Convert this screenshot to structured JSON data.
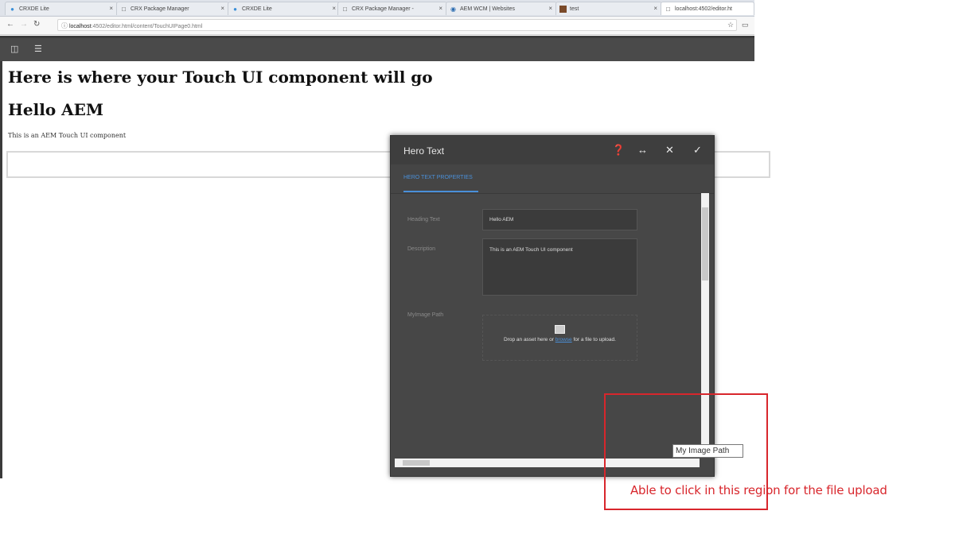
{
  "browser": {
    "tabs": [
      {
        "label": "CRXDE Lite",
        "icon": "crxde-icon"
      },
      {
        "label": "CRX Package Manager",
        "icon": "page-icon"
      },
      {
        "label": "CRXDE Lite",
        "icon": "crxde-icon"
      },
      {
        "label": "CRX Package Manager -",
        "icon": "page-icon"
      },
      {
        "label": "AEM WCM | Websites",
        "icon": "aem-icon"
      },
      {
        "label": "test",
        "icon": "image-icon"
      },
      {
        "label": "localhost:4502/editor.ht",
        "icon": "page-icon"
      }
    ],
    "url_host": "localhost",
    "url_rest": ":4502/editor.html/content/TouchUIPage0.html"
  },
  "page": {
    "heading1": "Here is where your Touch UI component will go",
    "heading2": "Hello AEM",
    "paragraph": "This is an AEM Touch UI component"
  },
  "dialog": {
    "title": "Hero Text",
    "tab_label": "HERO TEXT PROPERTIES",
    "fields": {
      "heading_label": "Heading Text",
      "heading_value": "Hello AEM",
      "description_label": "Description",
      "description_value": "This is an AEM Touch UI  component",
      "image_label": "MyImage Path",
      "drop_text_before": "Drop an asset here or ",
      "drop_link": "browse",
      "drop_text_after": " for a file to upload."
    }
  },
  "tooltip": "My Image Path",
  "annotation": "Able to click in this region for the file upload",
  "colors": {
    "annotation_red": "#d8262c",
    "accent_blue": "#4a90d9",
    "dialog_bg": "#474747"
  }
}
